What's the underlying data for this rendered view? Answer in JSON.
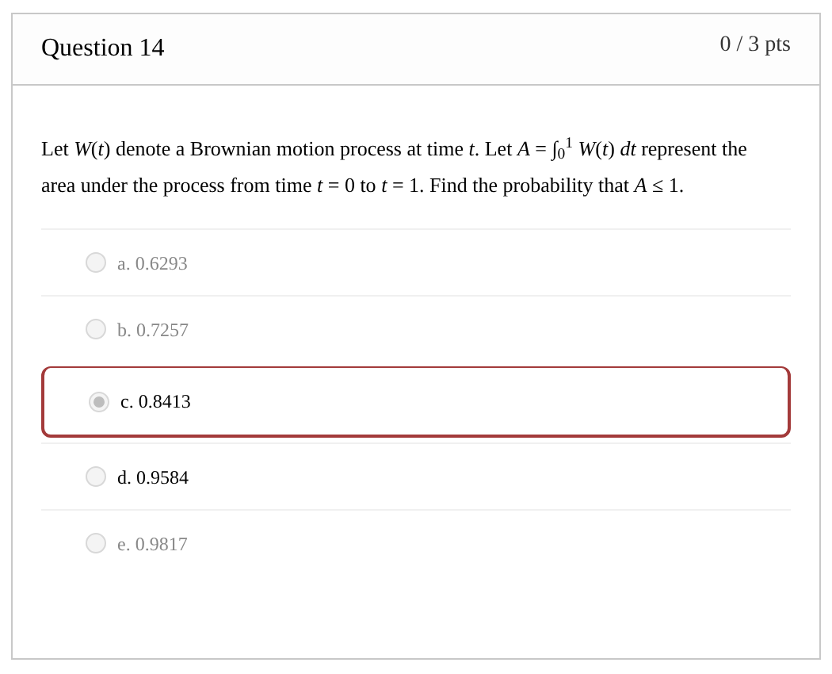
{
  "question": {
    "title": "Question 14",
    "points": "0 / 3 pts",
    "text": "Let *W*(*t*) denote a Brownian motion process at time *t*. Let *A* = ∫$_{0}$$^{1}$ *W*(*t*) *dt* represent the area under the process from time *t* = 0 to *t* = 1. Find the probability that *A* ≤ 1."
  },
  "options": [
    {
      "label": "a. 0.6293",
      "selected": false,
      "dimmed": true
    },
    {
      "label": "b. 0.7257",
      "selected": false,
      "dimmed": true
    },
    {
      "label": "c. 0.8413",
      "selected": true,
      "dimmed": false
    },
    {
      "label": "d. 0.9584",
      "selected": false,
      "dimmed": false
    },
    {
      "label": "e. 0.9817",
      "selected": false,
      "dimmed": true
    }
  ]
}
